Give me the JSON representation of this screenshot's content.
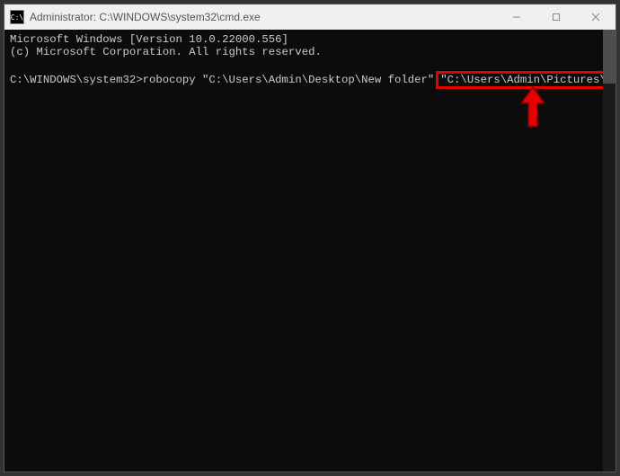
{
  "titlebar": {
    "icon_label": "C:\\",
    "title": "Administrator: C:\\WINDOWS\\system32\\cmd.exe"
  },
  "terminal": {
    "line1": "Microsoft Windows [Version 10.0.22000.556]",
    "line2": "(c) Microsoft Corporation. All rights reserved.",
    "blank": "",
    "prompt": "C:\\WINDOWS\\system32>",
    "command_part1": "robocopy \"C:\\Users\\Admin\\Desktop\\New folder\"",
    "command_highlighted": "\"C:\\Users\\Admin\\Pictures\\Copy\""
  }
}
